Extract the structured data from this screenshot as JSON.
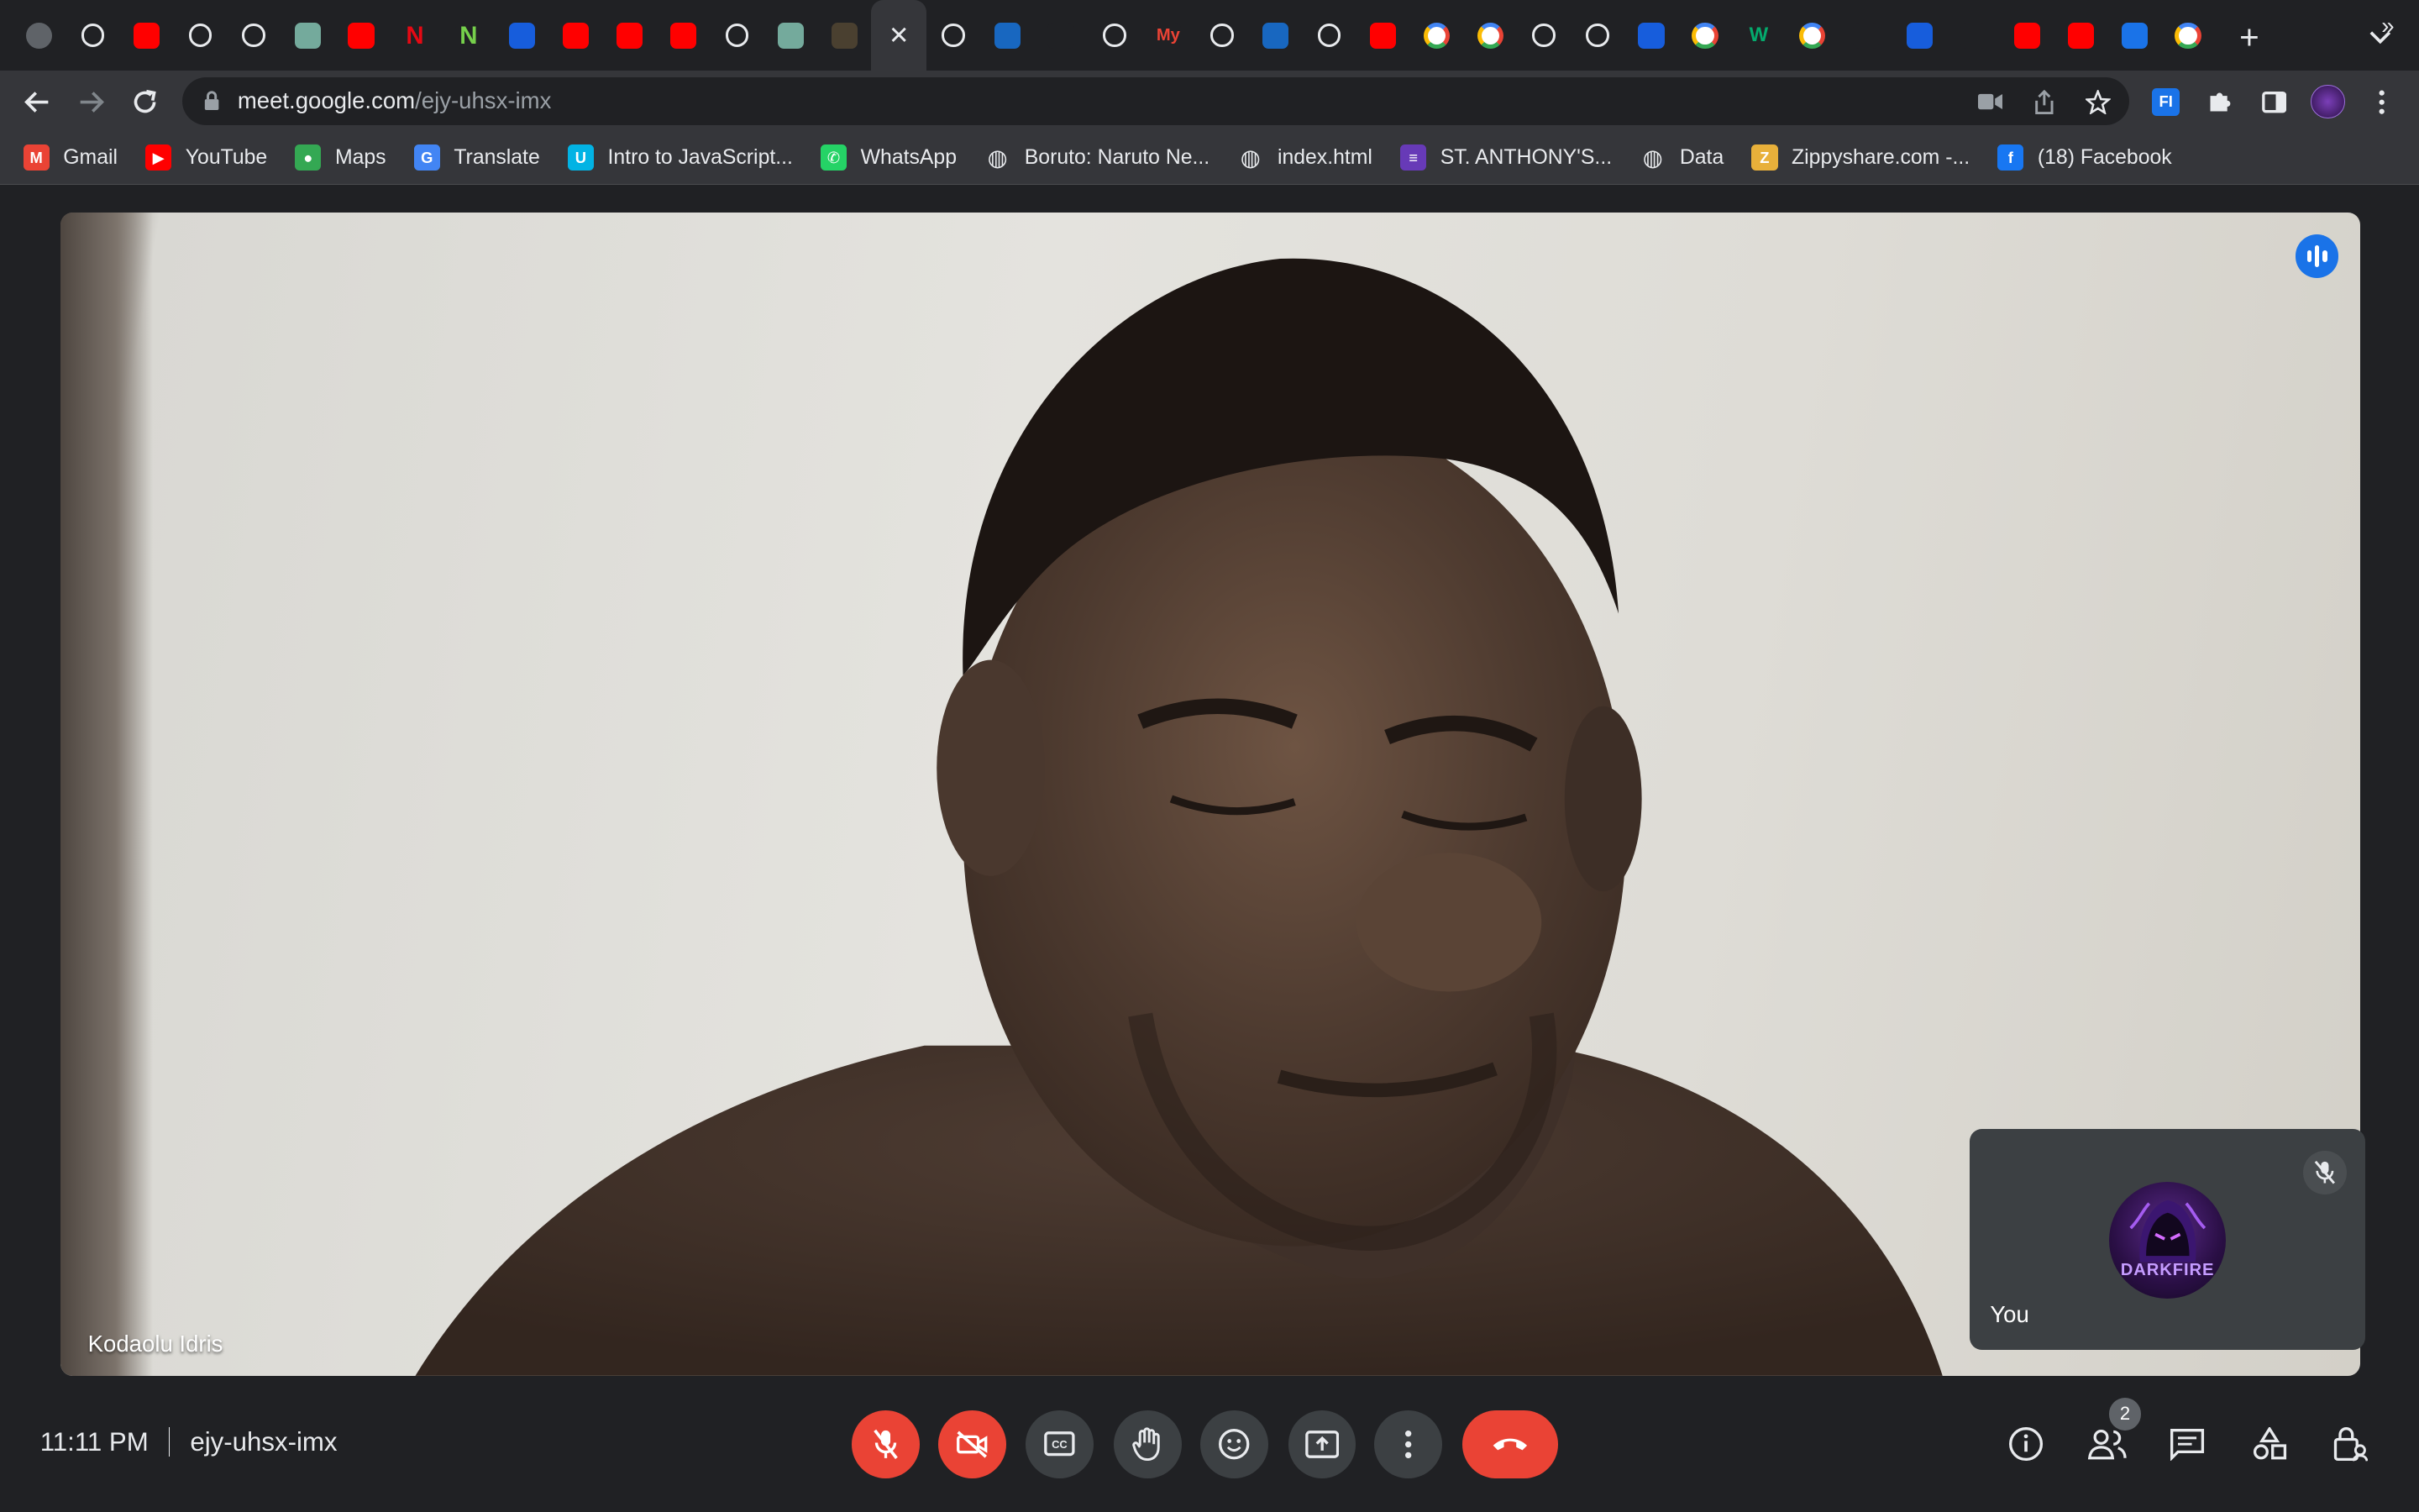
{
  "browser": {
    "tabs": [
      {
        "icon": "circle-tab-icon",
        "color": "#5f6368",
        "glyph": ""
      },
      {
        "icon": "github-icon",
        "color": "#202124",
        "glyph": ""
      },
      {
        "icon": "youtube-icon",
        "color": "#ff0000",
        "glyph": ""
      },
      {
        "icon": "globe-icon",
        "color": "#202124",
        "glyph": ""
      },
      {
        "icon": "globe-icon",
        "color": "#202124",
        "glyph": ""
      },
      {
        "icon": "chatgpt-icon",
        "color": "#74aa9c",
        "glyph": ""
      },
      {
        "icon": "youtube-icon",
        "color": "#ff0000",
        "glyph": ""
      },
      {
        "icon": "netflix-icon",
        "color": "#202124",
        "glyph": "N"
      },
      {
        "icon": "nodemon-icon",
        "color": "#202124",
        "glyph": "N"
      },
      {
        "icon": "bitwarden-icon",
        "color": "#175ddc",
        "glyph": ""
      },
      {
        "icon": "youtube-icon",
        "color": "#ff0000",
        "glyph": ""
      },
      {
        "icon": "youtube-icon",
        "color": "#ff0000",
        "glyph": ""
      },
      {
        "icon": "youtube-icon",
        "color": "#ff0000",
        "glyph": ""
      },
      {
        "icon": "globe-icon",
        "color": "#202124",
        "glyph": ""
      },
      {
        "icon": "chatgpt-icon",
        "color": "#74aa9c",
        "glyph": ""
      },
      {
        "icon": "img-tab-icon",
        "color": "#4a4030",
        "glyph": ""
      },
      {
        "icon": "close-icon",
        "color": "#35363a",
        "glyph": "✕",
        "active": true
      },
      {
        "icon": "globe-icon",
        "color": "#202124",
        "glyph": ""
      },
      {
        "icon": "vuetify-icon",
        "color": "#1867c0",
        "glyph": ""
      },
      {
        "icon": "laravel-icon",
        "color": "#202124",
        "glyph": ""
      },
      {
        "icon": "globe-icon",
        "color": "#202124",
        "glyph": ""
      },
      {
        "icon": "myjobmag-icon",
        "color": "#202124",
        "glyph": "My"
      },
      {
        "icon": "globe-icon",
        "color": "#202124",
        "glyph": ""
      },
      {
        "icon": "vuetify-icon",
        "color": "#1867c0",
        "glyph": ""
      },
      {
        "icon": "github-icon",
        "color": "#202124",
        "glyph": ""
      },
      {
        "icon": "youtube-icon",
        "color": "#ff0000",
        "glyph": ""
      },
      {
        "icon": "google-icon",
        "color": "#ffffff",
        "glyph": ""
      },
      {
        "icon": "google-icon",
        "color": "#ffffff",
        "glyph": ""
      },
      {
        "icon": "globe-icon",
        "color": "#202124",
        "glyph": ""
      },
      {
        "icon": "github-icon",
        "color": "#202124",
        "glyph": ""
      },
      {
        "icon": "bitwarden-icon",
        "color": "#175ddc",
        "glyph": ""
      },
      {
        "icon": "google-icon",
        "color": "#ffffff",
        "glyph": ""
      },
      {
        "icon": "w3schools-icon",
        "color": "#202124",
        "glyph": "W"
      },
      {
        "icon": "google-icon",
        "color": "#ffffff",
        "glyph": ""
      },
      {
        "icon": "stackoverflow-icon",
        "color": "#202124",
        "glyph": ""
      },
      {
        "icon": "bitwarden-icon",
        "color": "#175ddc",
        "glyph": ""
      },
      {
        "icon": "twitter-icon",
        "color": "#202124",
        "glyph": ""
      },
      {
        "icon": "youtube-icon",
        "color": "#ff0000",
        "glyph": ""
      },
      {
        "icon": "youtube-icon",
        "color": "#ff0000",
        "glyph": ""
      },
      {
        "icon": "vpn-icon",
        "color": "#1a73e8",
        "glyph": ""
      },
      {
        "icon": "google-icon",
        "color": "#ffffff",
        "glyph": ""
      }
    ],
    "omnibox": {
      "domain": "meet.google.com",
      "path": "/ejy-uhsx-imx"
    },
    "bookmarks": [
      {
        "label": "Gmail",
        "icon": "gmail-icon",
        "color": "#ea4335",
        "glyph": "M"
      },
      {
        "label": "YouTube",
        "icon": "youtube-icon",
        "color": "#ff0000",
        "glyph": "▶"
      },
      {
        "label": "Maps",
        "icon": "maps-icon",
        "color": "#34a853",
        "glyph": "●"
      },
      {
        "label": "Translate",
        "icon": "translate-icon",
        "color": "#4285f4",
        "glyph": "G"
      },
      {
        "label": "Intro to JavaScript...",
        "icon": "udacity-icon",
        "color": "#02b3e4",
        "glyph": "U"
      },
      {
        "label": "WhatsApp",
        "icon": "whatsapp-icon",
        "color": "#25d366",
        "glyph": "✆"
      },
      {
        "label": "Boruto: Naruto Ne...",
        "icon": "globe-icon",
        "color": "#5f6368",
        "glyph": "◍"
      },
      {
        "label": "index.html",
        "icon": "globe-icon",
        "color": "#5f6368",
        "glyph": "◍"
      },
      {
        "label": "ST. ANTHONY'S...",
        "icon": "forms-icon",
        "color": "#673ab7",
        "glyph": "≡"
      },
      {
        "label": "Data",
        "icon": "globe-icon",
        "color": "#5f6368",
        "glyph": "◍"
      },
      {
        "label": "Zippyshare.com -...",
        "icon": "zippyshare-icon",
        "color": "#e8b03a",
        "glyph": "Z"
      },
      {
        "label": "(18) Facebook",
        "icon": "facebook-icon",
        "color": "#1877f2",
        "glyph": "f"
      }
    ],
    "bookmarks_more": "»"
  },
  "meet": {
    "main_participant": "Kodaolu Idris",
    "self_label": "You",
    "avatar_text": "DARKFIRE",
    "time": "11:11 PM",
    "meeting_code": "ejy-uhsx-imx",
    "participant_count": "2"
  },
  "colors": {
    "accent": "#1a73e8",
    "danger": "#ea4335",
    "control_bg": "#3c4043"
  }
}
